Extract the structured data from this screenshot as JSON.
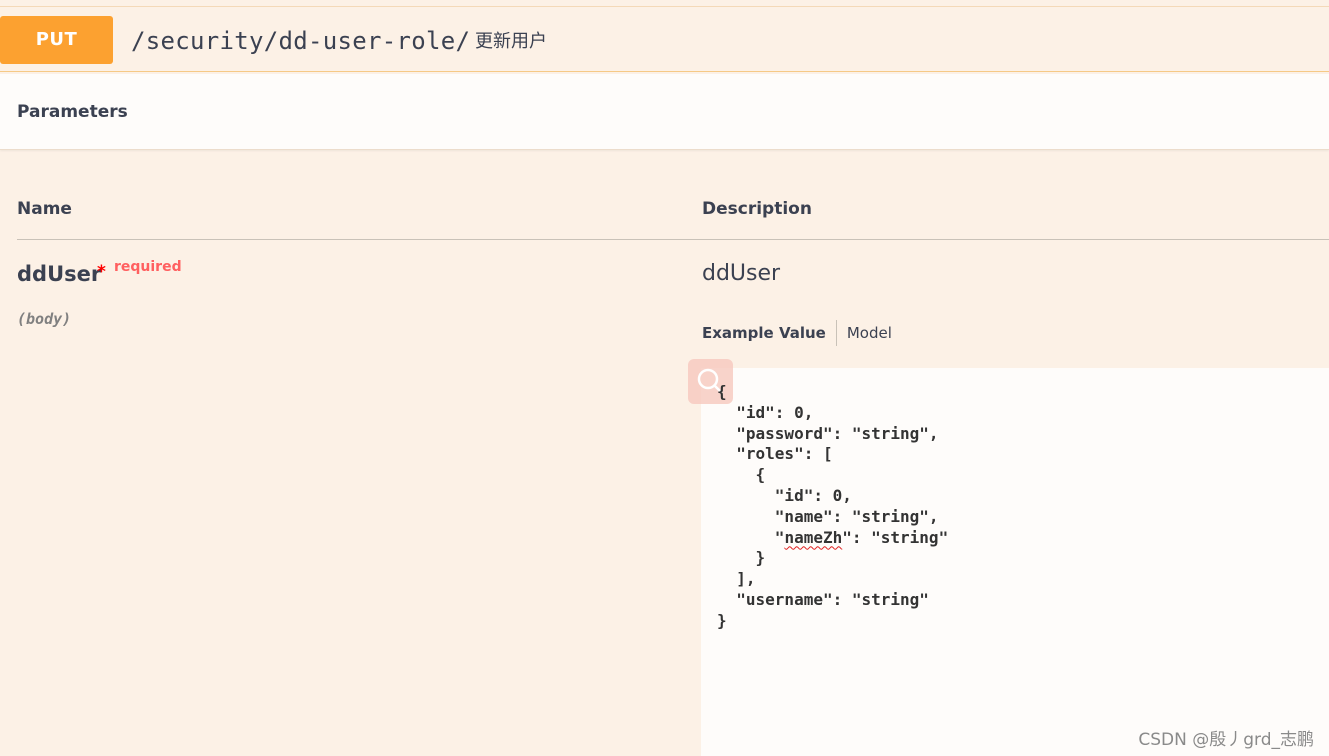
{
  "operation": {
    "method": "PUT",
    "path": "/security/dd-user-role/",
    "summary": "更新用户"
  },
  "parameters": {
    "title": "Parameters",
    "columns": {
      "name": "Name",
      "description": "Description"
    },
    "items": [
      {
        "name": "ddUser",
        "required_mark": "*",
        "required_label": "required",
        "in": "(body)",
        "description": "ddUser",
        "tabs": {
          "example": "Example Value",
          "model": "Model"
        },
        "example_lines": [
          "{",
          "  \"id\": 0,",
          "  \"password\": \"string\",",
          "  \"roles\": [",
          "    {",
          "      \"id\": 0,",
          "      \"name\": \"string\",",
          "      \"nameZh\": \"string\"",
          "    }",
          "  ],",
          "  \"username\": \"string\"",
          "}"
        ]
      }
    ]
  },
  "watermark": "CSDN @殷丿grd_志鹏",
  "colors": {
    "method_put": "#fca130",
    "background": "#fcf1e6",
    "required": "#ff6060",
    "text": "#3b4151"
  },
  "icons": {
    "copy": "search-icon"
  }
}
